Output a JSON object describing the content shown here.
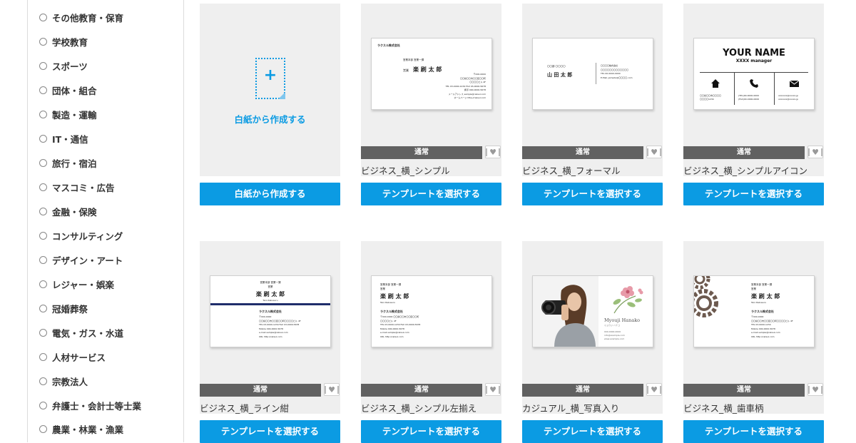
{
  "sidebar": {
    "categories": [
      "その他教育・保育",
      "学校教育",
      "スポーツ",
      "団体・組合",
      "製造・運輸",
      "IT・通信",
      "旅行・宿泊",
      "マスコミ・広告",
      "金融・保険",
      "コンサルティング",
      "デザイン・アート",
      "レジャー・娯楽",
      "冠婚葬祭",
      "電気・ガス・水道",
      "人材サービス",
      "宗教法人",
      "弁護士・会計士等士業",
      "農業・林業・漁業"
    ]
  },
  "blank_card": {
    "label": "白紙から作成する",
    "button": "白紙から作成する",
    "plus": "+"
  },
  "templates": [
    {
      "badge": "通常",
      "title": "ビジネス_横_シンプル",
      "button": "テンプレートを選択する"
    },
    {
      "badge": "通常",
      "title": "ビジネス_横_フォーマル",
      "button": "テンプレートを選択する"
    },
    {
      "badge": "通常",
      "title": "ビジネス_横_シンプルアイコン",
      "button": "テンプレートを選択する"
    },
    {
      "badge": "通常",
      "title": "ビジネス_横_ライン紺",
      "button": "テンプレートを選択する"
    },
    {
      "badge": "通常",
      "title": "ビジネス_横_シンプル左揃え",
      "button": "テンプレートを選択する"
    },
    {
      "badge": "通常",
      "title": "カジュアル_横_写真入り",
      "button": "テンプレートを選択する"
    },
    {
      "badge": "通常",
      "title": "ビジネス_横_歯車柄",
      "button": "テンプレートを選択する"
    }
  ],
  "previews": {
    "simple": {
      "company": "ラクスル株式会社",
      "dept": "営業本部 営業一課",
      "role": "営業",
      "name": "楽 刷 太 郎",
      "addr": [
        "〒000-0000",
        "〇〇県〇〇市〇〇区〇〇町",
        "〇〇〇〇ビル 4F",
        "TEL 03-0000-1234 FAX 03-0000-5678",
        "携帯 090-0000-5678",
        "メールアドレス sample@raksul.com",
        "ホームページ http://raksul.com"
      ]
    },
    "formal": {
      "left_small": "〇〇部 〇〇〇〇",
      "name": "山 田 太 郎",
      "right": [
        "〇〇〇〇株式会社",
        "〇〇〇〇〇〇〇〇〇〇〇〇〇",
        "TEL 00-0000-0000",
        "E-Mail yamada@〇〇〇〇.com"
      ]
    },
    "icon": {
      "name": "YOUR NAME",
      "subtitle": "XXXX manager",
      "home_text": [
        "〇〇県〇〇市〇〇〇〇",
        "〇〇〇〇1234"
      ],
      "phone_text": [
        "(TEL)00-0000-0000",
        "(FAX)00-0000-0000"
      ],
      "mail_text": [
        "xxxxxxx@xxxxx.jp",
        "xxxxxxx@xxxxx.jp"
      ],
      "home_icon": "home-icon",
      "phone_icon": "phone-icon",
      "mail_icon": "mail-icon"
    },
    "line_navy": {
      "dept": "営業本部 営業一課",
      "role": "営業",
      "name": "楽 刷 太 郎",
      "romaji": "Taro Rakusuru",
      "company": "ラクスル株式会社",
      "addr": [
        "〒000-0000",
        "〇〇県〇〇市〇〇区〇〇町〇〇〇〇ビル 4F",
        "TEL 03-0000-1234 FAX 03-0000-5678",
        "Mobile 090-0000-5678",
        "e-mail sample@raksul.com",
        "URL http://raksul.com"
      ],
      "accent": "#1f2d6b"
    },
    "left_align": {
      "dept": "営業本部 営業一課",
      "role": "営業",
      "name": "楽 刷 太 郎",
      "romaji": "Taro Rakusuru",
      "company": "ラクスル株式会社",
      "addr": [
        "〒000-0000 〇〇県〇〇市〇〇区〇〇町",
        "〇〇〇〇ビル 4F",
        "TEL 03-0000-1234 FAX 03-0000-5678",
        "Mobile 090-0000-5678",
        "e-mail sample@raksul.com",
        "URL http://raksul.com"
      ]
    },
    "photo": {
      "name": "Myouji Hanako",
      "kana": "ミョウジ ハナコ",
      "contact": [
        "000-0000-0000",
        "info@example.com",
        "www.example.com"
      ]
    },
    "gear": {
      "dept": "営業本部 営業一課",
      "role": "営業",
      "name": "楽 刷 太 郎",
      "romaji": "Taro Rakusuru",
      "company": "ラクスル株式会社",
      "addr": [
        "〒000-0000",
        "〇〇県〇〇市〇〇区〇〇町〇〇〇〇ビル 4F",
        "TEL 03-0000-1234",
        "Mobile 090-0000-5678",
        "e-mail sample@raksul.com",
        "URL http://raksul.com"
      ]
    }
  },
  "colors": {
    "accent": "#0b9be3",
    "badge": "#616161",
    "thumb_bg": "#efefef"
  }
}
